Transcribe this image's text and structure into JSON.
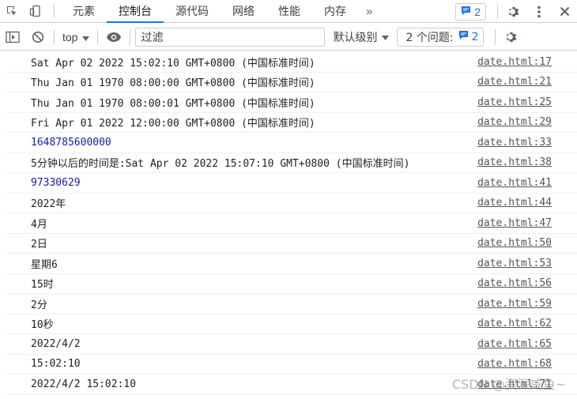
{
  "tabs": [
    {
      "label": "元素"
    },
    {
      "label": "控制台"
    },
    {
      "label": "源代码"
    },
    {
      "label": "网络"
    },
    {
      "label": "性能"
    },
    {
      "label": "内存"
    }
  ],
  "more_label": "»",
  "issue_badge_count": "2",
  "toolbar": {
    "context": "top",
    "filter_placeholder": "过滤",
    "levels_label": "默认级别",
    "issues_label": "2 个问题:",
    "issues_count": "2"
  },
  "log_rows": [
    {
      "text": "Sat Apr 02 2022 15:02:10 GMT+0800 (中国标准时间)",
      "source": "date.html:17",
      "type": "text"
    },
    {
      "text": "Thu Jan 01 1970 08:00:00 GMT+0800 (中国标准时间)",
      "source": "date.html:21",
      "type": "text"
    },
    {
      "text": "Thu Jan 01 1970 08:00:01 GMT+0800 (中国标准时间)",
      "source": "date.html:25",
      "type": "text"
    },
    {
      "text": "Fri Apr 01 2022 12:00:00 GMT+0800 (中国标准时间)",
      "source": "date.html:29",
      "type": "text"
    },
    {
      "text": "1648785600000",
      "source": "date.html:33",
      "type": "number"
    },
    {
      "text": "5分钟以后的时间是:Sat Apr 02 2022 15:07:10 GMT+0800 (中国标准时间)",
      "source": "date.html:38",
      "type": "text"
    },
    {
      "text": "97330629",
      "source": "date.html:41",
      "type": "number"
    },
    {
      "text": "2022年",
      "source": "date.html:44",
      "type": "text"
    },
    {
      "text": "4月",
      "source": "date.html:47",
      "type": "text"
    },
    {
      "text": "2日",
      "source": "date.html:50",
      "type": "text"
    },
    {
      "text": "星期6",
      "source": "date.html:53",
      "type": "text"
    },
    {
      "text": "15时",
      "source": "date.html:56",
      "type": "text"
    },
    {
      "text": "2分",
      "source": "date.html:59",
      "type": "text"
    },
    {
      "text": "10秒",
      "source": "date.html:62",
      "type": "text"
    },
    {
      "text": "2022/4/2",
      "source": "date.html:65",
      "type": "text"
    },
    {
      "text": "15:02:10",
      "source": "date.html:68",
      "type": "text"
    },
    {
      "text": "2022/4/2 15:02:10",
      "source": "date.html:71",
      "type": "text"
    }
  ],
  "watermark": "CSDN @资深咸鱼~",
  "colors": {
    "accent": "#1a73e8",
    "number": "#1a1aa6",
    "border": "#cbcdd1"
  }
}
